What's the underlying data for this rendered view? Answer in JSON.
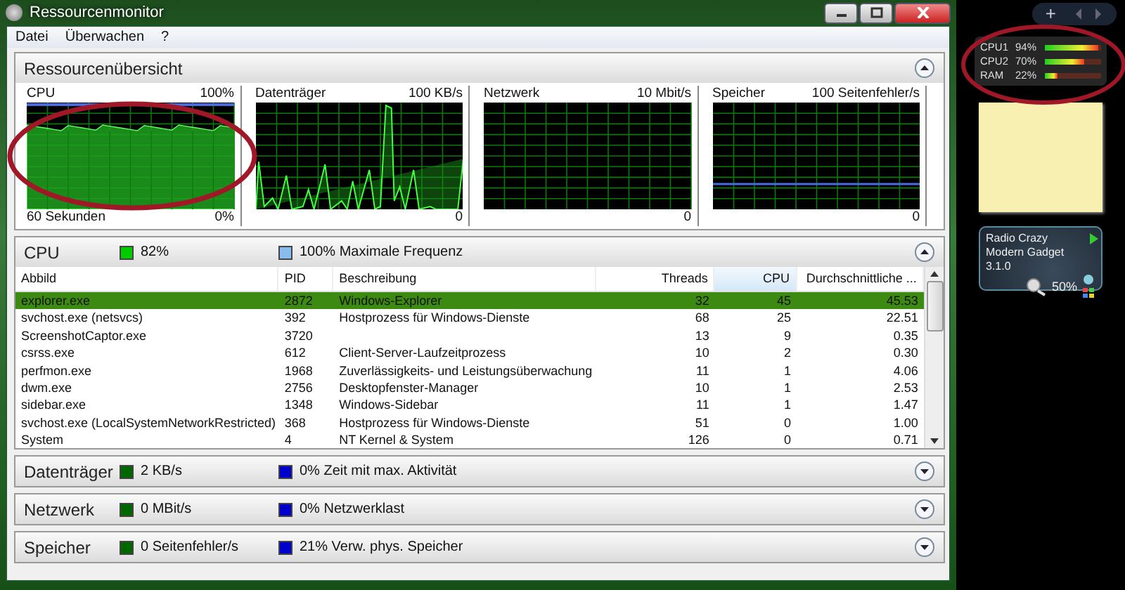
{
  "window": {
    "title": "Ressourcenmonitor"
  },
  "menu": [
    "Datei",
    "Überwachen",
    "?"
  ],
  "overview": {
    "title": "Ressourcenübersicht",
    "expanded": true,
    "graphs": [
      {
        "kind": "cpu",
        "label": "CPU",
        "max": "100%",
        "footer": "60 Sekunden",
        "value": "0%"
      },
      {
        "kind": "disk",
        "label": "Datenträger",
        "max": "100 KB/s",
        "value": "0"
      },
      {
        "kind": "network",
        "label": "Netzwerk",
        "max": "10 Mbit/s",
        "value": "0"
      },
      {
        "kind": "memory",
        "label": "Speicher",
        "max": "100 Seitenfehler/s",
        "value": "0"
      }
    ]
  },
  "cpu": {
    "title": "CPU",
    "expanded": true,
    "legend": [
      {
        "text": "82%",
        "color": "#00cc00"
      },
      {
        "text": "100% Maximale Frequenz",
        "color": "#88bbee"
      }
    ],
    "columns": [
      {
        "label": "Abbild",
        "selected": false
      },
      {
        "label": "PID",
        "selected": false
      },
      {
        "label": "Beschreibung",
        "selected": false
      },
      {
        "label": "Threads",
        "selected": false
      },
      {
        "label": "CPU",
        "selected": true
      },
      {
        "label": "Durchschnittliche ...",
        "selected": false
      }
    ],
    "rows": [
      {
        "selected": true,
        "cells": [
          "explorer.exe",
          "2872",
          "Windows-Explorer",
          "32",
          "45",
          "45.53"
        ]
      },
      {
        "selected": false,
        "cells": [
          "svchost.exe (netsvcs)",
          "392",
          "Hostprozess für Windows-Dienste",
          "68",
          "25",
          "22.51"
        ]
      },
      {
        "selected": false,
        "cells": [
          "ScreenshotCaptor.exe",
          "3720",
          "",
          "13",
          "9",
          "0.35"
        ]
      },
      {
        "selected": false,
        "cells": [
          "csrss.exe",
          "612",
          "Client-Server-Laufzeitprozess",
          "10",
          "2",
          "0.30"
        ]
      },
      {
        "selected": false,
        "cells": [
          "perfmon.exe",
          "1968",
          "Zuverlässigkeits- und Leistungsüberwachung",
          "11",
          "1",
          "4.06"
        ]
      },
      {
        "selected": false,
        "cells": [
          "dwm.exe",
          "2756",
          "Desktopfenster-Manager",
          "10",
          "1",
          "2.53"
        ]
      },
      {
        "selected": false,
        "cells": [
          "sidebar.exe",
          "1348",
          "Windows-Sidebar",
          "11",
          "1",
          "1.47"
        ]
      },
      {
        "selected": false,
        "cells": [
          "svchost.exe (LocalSystemNetworkRestricted)",
          "368",
          "Hostprozess für Windows-Dienste",
          "51",
          "0",
          "1.00"
        ]
      },
      {
        "selected": false,
        "cells": [
          "System",
          "4",
          "NT Kernel & System",
          "126",
          "0",
          "0.71"
        ]
      }
    ]
  },
  "sections": [
    {
      "title": "Datenträger",
      "expanded": false,
      "legend": [
        {
          "text": "2 KB/s",
          "color": "#006600"
        },
        {
          "text": "0% Zeit mit max. Aktivität",
          "color": "#0000cc"
        }
      ]
    },
    {
      "title": "Netzwerk",
      "expanded": false,
      "legend": [
        {
          "text": "0 MBit/s",
          "color": "#006600"
        },
        {
          "text": "0% Netzwerklast",
          "color": "#0000cc"
        }
      ]
    },
    {
      "title": "Speicher",
      "expanded": false,
      "legend": [
        {
          "text": "0 Seitenfehler/s",
          "color": "#006600"
        },
        {
          "text": "21% Verw. phys. Speicher",
          "color": "#0000cc"
        }
      ]
    }
  ],
  "gadgets": {
    "add_button": "+",
    "meters": [
      {
        "label": "CPU1",
        "reading": "94%",
        "level": 0.94
      },
      {
        "label": "CPU2",
        "reading": "70%",
        "level": 0.7
      },
      {
        "label": "RAM",
        "reading": "22%",
        "level": 0.22
      }
    ],
    "radio": {
      "title": "Radio Crazy Modern Gadget 3.1.0",
      "volume": "50%"
    }
  }
}
